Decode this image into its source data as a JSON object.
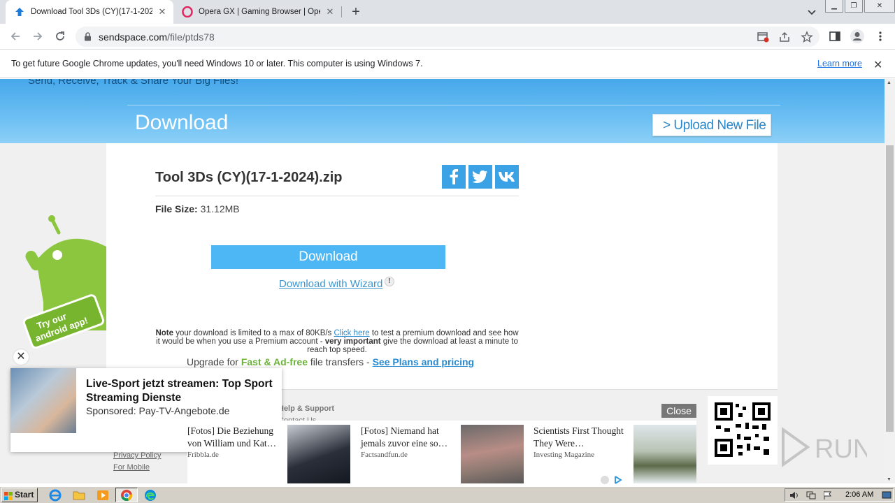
{
  "browser": {
    "tabs": [
      {
        "title": "Download Tool 3Ds (CY)(17-1-2024).zip",
        "active": true
      },
      {
        "title": "Opera GX | Gaming Browser | Opera",
        "active": false
      }
    ],
    "url_host": "sendspace.com",
    "url_path": "/file/ptds78",
    "infobar_message": "To get future Google Chrome updates, you'll need Windows 10 or later. This computer is using Windows 7.",
    "infobar_link": "Learn more"
  },
  "page": {
    "tagline": "Send, Receive, Track & Share Your Big Files!",
    "hero_title": "Download",
    "upload_button": "> Upload New File",
    "file_name": "Tool 3Ds (CY)(17-1-2024).zip",
    "file_size_label": "File Size:",
    "file_size_value": "31.12MB",
    "download_button": "Download",
    "wizard_link": "Download with Wizard",
    "note": {
      "bold1": "Note",
      "text1": " your download is limited to a max of 80KB/s ",
      "link": "Click here",
      "text2": " to test a premium download and see how it would be when you use a Premium account - ",
      "bold2": "very important",
      "text3": " give the download at least a minute to reach top speed."
    },
    "upgrade": {
      "prefix": "Upgrade for ",
      "green": "Fast & Ad-free",
      "middle": " file transfers - ",
      "link": "See Plans and pricing"
    },
    "android_promo": "Try our android app!",
    "footer": {
      "help": "Help & Support",
      "contact": "Contact Us",
      "privacy": "Privacy Policy",
      "mobile": "For Mobile"
    }
  },
  "popup_ad": {
    "title": "Live-Sport jetzt streamen: Top Sport Streaming Dienste",
    "sponsor": "Sponsored: Pay-TV-Angebote.de"
  },
  "ad_strip": {
    "close_label": "Close",
    "items": [
      {
        "title": "[Fotos] Die Beziehung von William und Kat…",
        "source": "Fribbla.de"
      },
      {
        "title": "[Fotos] Niemand hat jemals zuvor eine so…",
        "source": "Factsandfun.de"
      },
      {
        "title": "Scientists First Thought They Were…",
        "source": "Investing Magazine"
      }
    ]
  },
  "watermark": "RUN",
  "taskbar": {
    "start_label": "Start",
    "time": "2:06 AM"
  },
  "colors": {
    "accent_blue": "#4db6f5",
    "link_blue": "#2a8bd0",
    "green": "#6cb23a"
  }
}
